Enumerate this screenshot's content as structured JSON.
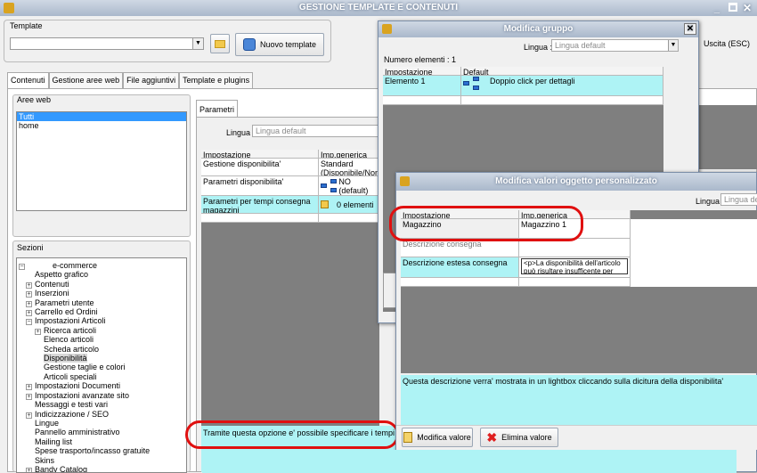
{
  "window": {
    "title": "GESTIONE TEMPLATE E CONTENUTI"
  },
  "template": {
    "label": "Template",
    "select_value": "",
    "new_button": "Nuovo template"
  },
  "tabs": [
    "Contenuti",
    "Gestione aree web",
    "File aggiuntivi",
    "Template e plugins"
  ],
  "aree_web": {
    "label": "Aree web",
    "items": [
      "Tutti",
      "home"
    ]
  },
  "sezioni": {
    "label": "Sezioni",
    "tree": [
      "e-commerce",
      "Aspetto grafico",
      "Contenuti",
      "Inserzioni",
      "Parametri utente",
      "Carrello ed Ordini",
      "Impostazioni Articoli",
      "Ricerca articoli",
      "Elenco articoli",
      "Scheda articolo",
      "Disponibilità",
      "Gestione taglie e colori",
      "Articoli speciali",
      "Impostazioni Documenti",
      "Impostazioni avanzate sito",
      "Messaggi e testi vari",
      "Indicizzazione / SEO",
      "Lingue",
      "Pannello amministrativo",
      "Mailing list",
      "Spese trasporto/incasso gratuite",
      "Skins",
      "Bandy Catalog"
    ]
  },
  "parametri": {
    "tab": "Parametri",
    "lingua_label": "Lingua :",
    "lingua_placeholder": "Lingua default",
    "headers": [
      "Impostazione",
      "Imp.generica"
    ],
    "rows": [
      {
        "name": "Gestione disponibilita'",
        "value": "Standard (Disponibile/Non disponibile)"
      },
      {
        "name": "Parametri disponibilita'",
        "value": "NO (default)"
      },
      {
        "name": "Parametri per tempi consegna magazzini",
        "value": "0 elementi"
      }
    ],
    "description": "Tramite questa opzione e' possibile specificare i tempi di consegna per magazzino"
  },
  "uscita": "Uscita (ESC)",
  "modifica_gruppo": {
    "title": "Modifica gruppo",
    "lingua_label": "Lingua :",
    "lingua_value": "Lingua default",
    "count": "Numero elementi : 1",
    "headers": [
      "Impostazione",
      "Default"
    ],
    "rows": [
      {
        "name": "Elemento 1",
        "value": "Doppio click per dettagli"
      }
    ]
  },
  "modifica_valori": {
    "title": "Modifica valori oggetto personalizzato",
    "lingua_label": "Lingua :",
    "lingua_value": "Lingua default",
    "headers": [
      "Impostazione",
      "Imp.generica"
    ],
    "rows": [
      {
        "name": "Magazzino",
        "value": "Magazzino 1"
      },
      {
        "name": "Descrizione consegna",
        "value": ""
      },
      {
        "name": "Descrizione estesa consegna",
        "value": "<p>La disponibilità dell'articolo può risultare insufficente per"
      }
    ],
    "description": "Questa descrizione verra' mostrata in un lightbox cliccando sulla dicitura della disponibilita'",
    "btn_modifica": "Modifica valore",
    "btn_elimina": "Elimina valore"
  },
  "colors": {
    "accent_cyan": "#aef3f5",
    "highlight_red": "#e01010",
    "panel_gray": "#7f7f7f"
  }
}
